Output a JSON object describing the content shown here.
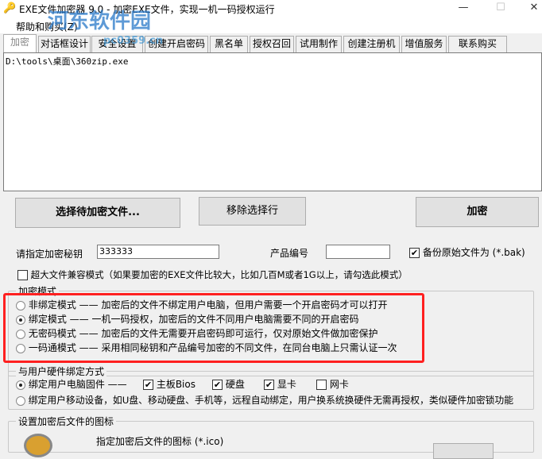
{
  "window": {
    "title": "EXE文件加密器 9.0 - 加密EXE文件，实现一机一码授权运行",
    "minimize": "—",
    "maximize": "☐",
    "close": "✕"
  },
  "watermark": {
    "text": "河东软件园",
    "url": "pc0359.cn"
  },
  "menu": {
    "help": "帮助和购买(Z)"
  },
  "tabs": [
    "加密",
    "对话框设计",
    "安全设置",
    "创建开启密码",
    "黑名单",
    "授权召回",
    "试用制作",
    "创建注册机",
    "增值服务",
    "联系购买"
  ],
  "file_list": [
    "D:\\tools\\桌面\\360zip.exe"
  ],
  "buttons": {
    "select": "选择待加密文件...",
    "remove": "移除选择行",
    "encrypt": "加密"
  },
  "key": {
    "label": "请指定加密秘钥",
    "value": "333333"
  },
  "product": {
    "label": "产品编号",
    "value": ""
  },
  "backup": {
    "label": "备份原始文件为 (*.bak)",
    "checked": true
  },
  "large_file": {
    "label": "超大文件兼容模式（如果要加密的EXE文件比较大，比如几百M或者1G以上，请勾选此模式）",
    "checked": false
  },
  "mode": {
    "legend": "加密模式",
    "options": [
      {
        "label": "非绑定模式 —— 加密后的文件不绑定用户电脑，但用户需要一个开启密码才可以打开",
        "selected": false
      },
      {
        "label": "绑定模式 —— 一机一码授权，加密后的文件不同用户电脑需要不同的开启密码",
        "selected": true
      },
      {
        "label": "无密码模式 —— 加密后的文件无需要开启密码即可运行，仅对原始文件做加密保护",
        "selected": false
      },
      {
        "label": "一码通模式 —— 采用相同秘钥和产品编号加密的不同文件，在同台电脑上只需认证一次",
        "selected": false
      }
    ],
    "highlight_color": "#ff2020"
  },
  "hardware": {
    "legend": "与用户硬件绑定方式",
    "firmware": "绑定用户电脑固件 ——",
    "bios": "主板Bios",
    "disk": "硬盘",
    "gpu": "显卡",
    "nic": "网卡",
    "mobile": "绑定用户移动设备，如U盘、移动硬盘、手机等，远程自动绑定，用户换系统换硬件无需再授权，类似硬件加密锁功能"
  },
  "icon_group": {
    "legend": "设置加密后文件的图标",
    "label": "指定加密后文件的图标 (*.ico)"
  }
}
